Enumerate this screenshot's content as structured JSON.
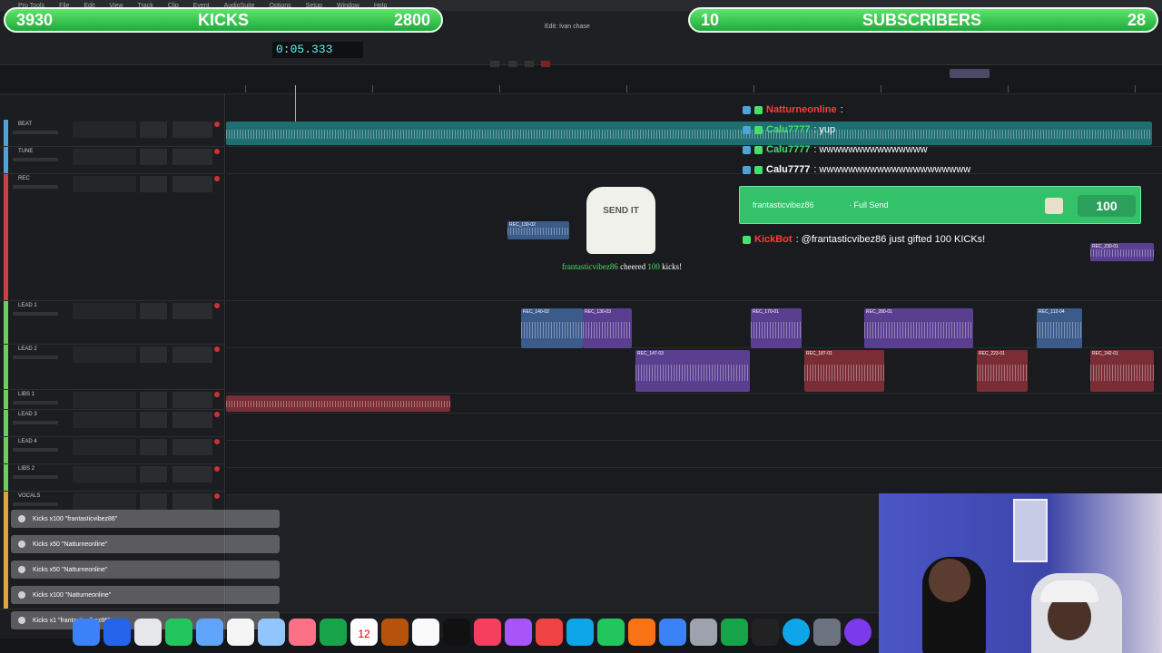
{
  "menu": {
    "items": [
      "Pro Tools",
      "File",
      "Edit",
      "View",
      "Track",
      "Clip",
      "Event",
      "AudioSuite",
      "Options",
      "Setup",
      "Window",
      "Help"
    ]
  },
  "transport": {
    "counter": "0:05.333",
    "edit_title": "Edit: Ivan chase"
  },
  "overlay": {
    "kicks_left": "3930",
    "kicks_label": "KICKS",
    "kicks_right": "2800",
    "subs_left": "10",
    "subs_label": "SUBSCRIBERS",
    "subs_right": "28"
  },
  "tracks": [
    {
      "name": "BEAT",
      "color": "#4fa3d6"
    },
    {
      "name": "TUNE",
      "color": "#4fa3d6"
    },
    {
      "name": "REC",
      "color": "#d23b46"
    },
    {
      "name": "LEAD 1",
      "color": "#6bd15a"
    },
    {
      "name": "LEAD 2",
      "color": "#6bd15a"
    },
    {
      "name": "LIBS 1",
      "color": "#6bd15a"
    },
    {
      "name": "LEAD 3",
      "color": "#6bd15a"
    },
    {
      "name": "LEAD 4",
      "color": "#6bd15a"
    },
    {
      "name": "LIBS 2",
      "color": "#6bd15a"
    },
    {
      "name": "VOCALS",
      "color": "#e0a532"
    }
  ],
  "clips": {
    "rec1": "REC_130-02",
    "rec_top": "REC_230-01",
    "lead1_a": "REC_140-02",
    "lead1_b": "REC_130-03",
    "lead1_c": "REC_170-01",
    "lead1_d": "REC_280-01",
    "lead1_e": "REC_112-04",
    "lead2_a": "REC_147-03",
    "lead2_b": "REC_187-01",
    "lead2_c": "REC_223-01",
    "lead2_d": "REC_242-01"
  },
  "chat": [
    {
      "user": "Natturneonline",
      "text": ":",
      "color": "#ff3b3b"
    },
    {
      "user": "Calu7777",
      "text": ": yup",
      "color": "#46e06d"
    },
    {
      "user": "Calu7777",
      "text": ": wwwwwwwwwwwwwww",
      "color": "#46e06d"
    },
    {
      "user": "Calu7777",
      "text": ": wwwwwwwwwwwwwwwwwwwww",
      "color": "#ffffff"
    }
  ],
  "gift_banner": {
    "user": "frantasticvibez86",
    "action": "· Full Send",
    "amount": "100"
  },
  "bot_message": {
    "user": "KickBot",
    "text": ": @frantasticvibez86 just gifted 100 KICKs!"
  },
  "cheer": {
    "shirt_text": "SEND IT",
    "user": "frantasticvibez86",
    "text_mid": "cheered",
    "amount": "100",
    "text_end": "kicks!"
  },
  "alerts": [
    "Kicks x100 \"frantasticvibez86\"",
    "Kicks x50 \"Natturneonline\"",
    "Kicks x50 \"Natturneonline\"",
    "Kicks x100 \"Natturneonline\"",
    "Kicks x1 \"frantasticvibez86\""
  ],
  "dock": {
    "calendar_day": "12"
  }
}
